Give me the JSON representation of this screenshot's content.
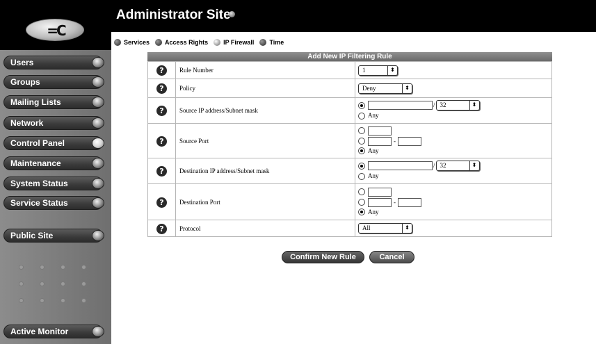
{
  "header": {
    "title": "Administrator Site",
    "logo_icon": "company-logo"
  },
  "sidebar": {
    "items": [
      {
        "label": "Users"
      },
      {
        "label": "Groups"
      },
      {
        "label": "Mailing Lists"
      },
      {
        "label": "Network"
      },
      {
        "label": "Control Panel",
        "active": true
      },
      {
        "label": "Maintenance"
      },
      {
        "label": "System Status"
      },
      {
        "label": "Service Status"
      },
      {
        "label": "Public Site"
      },
      {
        "label": "Active Monitor"
      }
    ]
  },
  "subnav": {
    "items": [
      {
        "label": "Services"
      },
      {
        "label": "Access Rights"
      },
      {
        "label": "IP Firewall",
        "active": true
      },
      {
        "label": "Time"
      }
    ]
  },
  "form": {
    "heading": "Add New IP Filtering Rule",
    "help_glyph": "?",
    "rows": {
      "rule_number": {
        "label": "Rule Number",
        "value": "1"
      },
      "policy": {
        "label": "Policy",
        "value": "Deny"
      },
      "source_ip": {
        "label": "Source IP address/Subnet mask",
        "mask": "32",
        "slash": "/",
        "any_label": "Any",
        "selected": "address"
      },
      "source_port": {
        "label": "Source Port",
        "dash": "-",
        "any_label": "Any",
        "selected": "any"
      },
      "dest_ip": {
        "label": "Destination IP address/Subnet mask",
        "mask": "32",
        "slash": "/",
        "any_label": "Any",
        "selected": "address"
      },
      "dest_port": {
        "label": "Destination Port",
        "dash": "-",
        "any_label": "Any",
        "selected": "any"
      },
      "protocol": {
        "label": "Protocol",
        "value": "All"
      }
    }
  },
  "actions": {
    "confirm_label": "Confirm New Rule",
    "cancel_label": "Cancel"
  },
  "select_arrows": "⬍"
}
